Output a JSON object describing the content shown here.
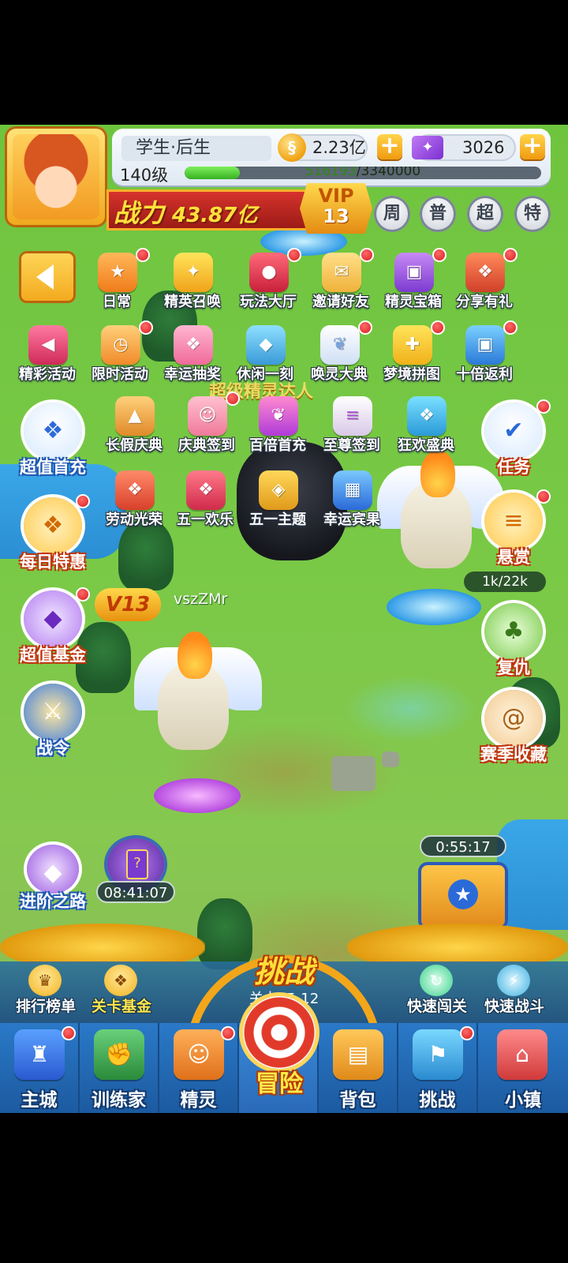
{
  "player": {
    "name": "学生·后生",
    "level": "140级",
    "exp_current": "516193",
    "exp_sep": "/",
    "exp_max": "3340000",
    "exp_fraction": 0.155,
    "power_label": "战力",
    "power_value": "43.87亿",
    "vip_label": "VIP",
    "vip_level": "13"
  },
  "resources": {
    "coins": "2.23亿",
    "coin_icon": "coin-icon",
    "gems": "3026",
    "gem_icon": "gem-icon",
    "plus": "+"
  },
  "quick_buttons": [
    "周",
    "普",
    "超",
    "特"
  ],
  "features_row1": [
    "日常",
    "精英召唤",
    "玩法大厅",
    "邀请好友",
    "精灵宝箱",
    "分享有礼"
  ],
  "features_row2": [
    "精彩活动",
    "限时活动",
    "幸运抽奖",
    "休闲一刻",
    "唤灵大典",
    "梦境拼图",
    "十倍返利"
  ],
  "features_row3": [
    "长假庆典",
    "庆典签到",
    "百倍首充",
    "至尊签到",
    "狂欢盛典"
  ],
  "features_row4": [
    "劳动光荣",
    "五一欢乐",
    "五一主题",
    "幸运宾果"
  ],
  "left_side": [
    "超值首充",
    "每日特惠",
    "超值基金",
    "战令"
  ],
  "right_side": [
    "任务",
    "悬赏",
    "复仇",
    "赛季收藏"
  ],
  "bounty_progress": "1k/22k",
  "banner_text": "超级精灵达人",
  "vip_tag": "V13",
  "player_tag": "vszZMr",
  "advance_label": "进阶之路",
  "card_timer": "08:41:07",
  "chest_timer": "0:55:17",
  "actions": {
    "rank": "排行榜单",
    "fund": "关卡基金",
    "quick_pass": "快速闯关",
    "quick_battle": "快速战斗"
  },
  "challenge": {
    "title": "挑战",
    "stage": "关卡25-12"
  },
  "nav": {
    "main_city": "主城",
    "trainer": "训练家",
    "spirit": "精灵",
    "adventure": "冒险",
    "bag": "背包",
    "challenge": "挑战",
    "town": "小镇"
  },
  "colors": {
    "accent_gold": "#f3b21d",
    "notify_red": "#d71e1e",
    "nav_blue": "#2a79c7",
    "grass": "#78c945"
  }
}
